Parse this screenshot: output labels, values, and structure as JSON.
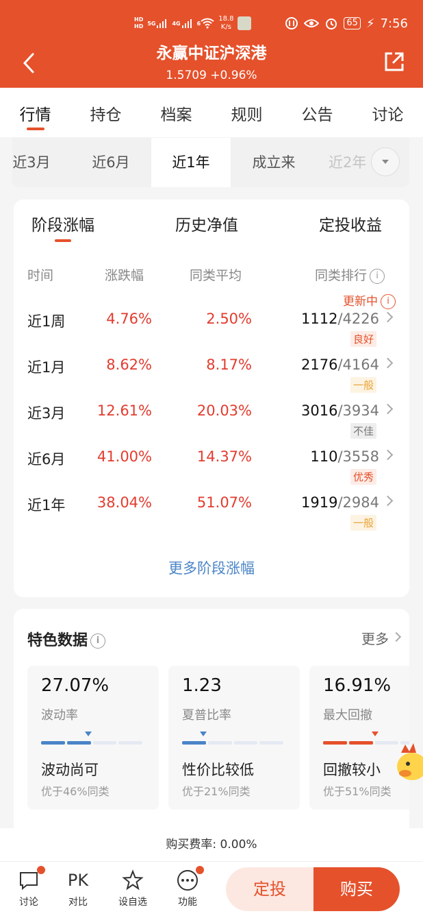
{
  "status_bar": {
    "hd1": "HD",
    "hd2": "HD",
    "net1": "5G",
    "net2": "4G",
    "net3": "6",
    "speed_value": "18.8",
    "speed_unit": "K/s",
    "battery": "65",
    "time": "7:56"
  },
  "header": {
    "title": "永赢中证沪深港",
    "nav": "1.5709",
    "change": "+0.96%",
    "accent_color": "#e5512b"
  },
  "main_tabs": [
    "行情",
    "持仓",
    "档案",
    "规则",
    "公告",
    "讨论"
  ],
  "periods": [
    "近3月",
    "近6月",
    "近1年",
    "成立来",
    "近2年"
  ],
  "perf_card": {
    "tabs": [
      "阶段涨幅",
      "历史净值",
      "定投收益"
    ],
    "headers": {
      "time": "时间",
      "change": "涨跌幅",
      "peer_avg": "同类平均",
      "rank": "同类排行"
    },
    "update_label": "更新中",
    "rows": [
      {
        "period": "近1周",
        "change": "4.76%",
        "avg": "2.50%",
        "rank": "1112",
        "total": "/4226",
        "badge": "良好"
      },
      {
        "period": "近1月",
        "change": "8.62%",
        "avg": "8.17%",
        "rank": "2176",
        "total": "/4164",
        "badge": "一般"
      },
      {
        "period": "近3月",
        "change": "12.61%",
        "avg": "20.03%",
        "rank": "3016",
        "total": "/3934",
        "badge": "不佳"
      },
      {
        "period": "近6月",
        "change": "41.00%",
        "avg": "14.37%",
        "rank": "110",
        "total": "/3558",
        "badge": "优秀"
      },
      {
        "period": "近1年",
        "change": "38.04%",
        "avg": "51.07%",
        "rank": "1919",
        "total": "/2984",
        "badge": "一般"
      }
    ],
    "more_link": "更多阶段涨幅"
  },
  "features": {
    "title": "特色数据",
    "more": "更多",
    "metrics": [
      {
        "value": "27.07%",
        "name": "波动率",
        "verdict": "波动尚可",
        "note": "优于46%同类",
        "level": 0.46
      },
      {
        "value": "1.23",
        "name": "夏普比率",
        "verdict": "性价比较低",
        "note": "优于21%同类",
        "level": 0.21
      },
      {
        "value": "16.91%",
        "name": "最大回撤",
        "verdict": "回撤较小",
        "note": "优于51%同类",
        "level": 0.51
      }
    ]
  },
  "fee": "购买费率: 0.00%",
  "bottom_nav": {
    "discuss": "讨论",
    "pk_icon_text": "PK",
    "compare": "对比",
    "watchlist": "设自选",
    "functions": "功能",
    "sip": "定投",
    "buy": "购买"
  }
}
